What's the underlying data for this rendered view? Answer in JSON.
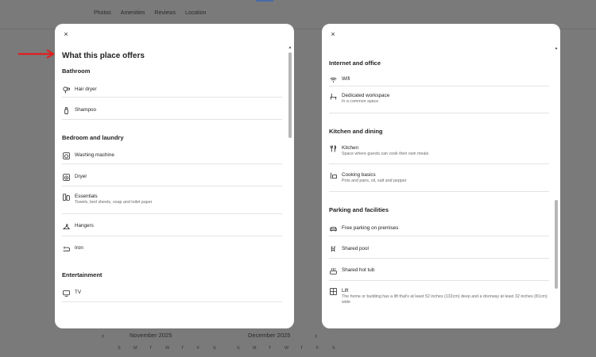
{
  "background": {
    "nav": [
      "Photos",
      "Amenities",
      "Reviews",
      "Location"
    ],
    "calendar": {
      "prev_icon": "chevron-left-icon",
      "next_icon": "chevron-right-icon",
      "month1": "November 2025",
      "month2": "December 2025",
      "weekdays": [
        "S",
        "M",
        "T",
        "W",
        "T",
        "F",
        "S"
      ]
    }
  },
  "left_modal": {
    "close_icon": "×",
    "title": "What this place offers",
    "sections": [
      {
        "title": "Bathroom",
        "items": [
          {
            "icon": "hair-dryer-icon",
            "name": "Hair dryer",
            "desc": ""
          },
          {
            "icon": "shampoo-icon",
            "name": "Shampoo",
            "desc": ""
          }
        ]
      },
      {
        "title": "Bedroom and laundry",
        "items": [
          {
            "icon": "washing-machine-icon",
            "name": "Washing machine",
            "desc": ""
          },
          {
            "icon": "dryer-icon",
            "name": "Dryer",
            "desc": ""
          },
          {
            "icon": "essentials-icon",
            "name": "Essentials",
            "desc": "Towels, bed sheets, soap and toilet paper"
          },
          {
            "icon": "hanger-icon",
            "name": "Hangers",
            "desc": ""
          },
          {
            "icon": "iron-icon",
            "name": "Iron",
            "desc": ""
          }
        ]
      },
      {
        "title": "Entertainment",
        "items": [
          {
            "icon": "tv-icon",
            "name": "TV",
            "desc": ""
          }
        ]
      }
    ]
  },
  "right_modal": {
    "close_icon": "×",
    "sections": [
      {
        "title": "Internet and office",
        "items": [
          {
            "icon": "wifi-icon",
            "name": "Wifi",
            "desc": ""
          },
          {
            "icon": "workspace-icon",
            "name": "Dedicated workspace",
            "desc": "In a common space"
          }
        ]
      },
      {
        "title": "Kitchen and dining",
        "items": [
          {
            "icon": "kitchen-icon",
            "name": "Kitchen",
            "desc": "Space where guests can cook their own meals"
          },
          {
            "icon": "cooking-basics-icon",
            "name": "Cooking basics",
            "desc": "Pots and pans, oil, salt and pepper"
          }
        ]
      },
      {
        "title": "Parking and facilities",
        "items": [
          {
            "icon": "car-icon",
            "name": "Free parking on premises",
            "desc": ""
          },
          {
            "icon": "pool-icon",
            "name": "Shared pool",
            "desc": ""
          },
          {
            "icon": "hot-tub-icon",
            "name": "Shared hot tub",
            "desc": ""
          },
          {
            "icon": "lift-icon",
            "name": "Lift",
            "desc": "The home or building has a lift that's at least 52 inches (132cm) deep and a doorway at least 32 inches (81cm) wide"
          }
        ]
      }
    ]
  },
  "annotation": {
    "icon": "red-arrow-icon",
    "color": "#e02020"
  }
}
